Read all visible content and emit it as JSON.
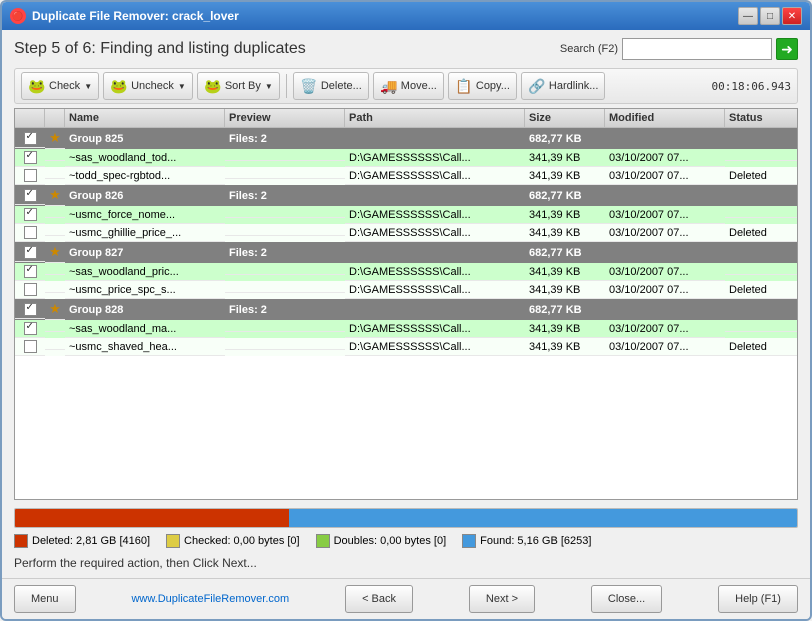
{
  "window": {
    "title": "Duplicate File Remover: crack_lover",
    "title_icon": "🔴"
  },
  "title_buttons": {
    "minimize": "—",
    "maximize": "□",
    "close": "✕"
  },
  "header": {
    "step_title": "Step 5 of 6: Finding and listing duplicates",
    "search_label": "Search (F2)",
    "search_placeholder": "",
    "go_arrow": "➜"
  },
  "toolbar": {
    "check_label": "Check",
    "uncheck_label": "Uncheck",
    "sort_label": "Sort By",
    "delete_label": "Delete...",
    "move_label": "Move...",
    "copy_label": "Copy...",
    "hardlink_label": "Hardlink...",
    "timer": "00:18:06.943"
  },
  "table": {
    "columns": [
      "",
      "",
      "Name",
      "Preview",
      "Path",
      "Size",
      "Modified",
      "Status"
    ],
    "groups": [
      {
        "id": "Group 825",
        "files": "Files: 2",
        "size": "682,77 KB",
        "rows": [
          {
            "checked": true,
            "name": "~sas_woodland_tod...",
            "path": "D:\\GAMESSSSSS\\Call...",
            "size": "341,39 KB",
            "modified": "03/10/2007 07...",
            "status": "",
            "green": true
          },
          {
            "checked": false,
            "name": "~todd_spec-rgbtod...",
            "path": "D:\\GAMESSSSSS\\Call...",
            "size": "341,39 KB",
            "modified": "03/10/2007 07...",
            "status": "Deleted",
            "green": false
          }
        ]
      },
      {
        "id": "Group 826",
        "files": "Files: 2",
        "size": "682,77 KB",
        "rows": [
          {
            "checked": true,
            "name": "~usmc_force_nome...",
            "path": "D:\\GAMESSSSSS\\Call...",
            "size": "341,39 KB",
            "modified": "03/10/2007 07...",
            "status": "",
            "green": true
          },
          {
            "checked": false,
            "name": "~usmc_ghillie_price_...",
            "path": "D:\\GAMESSSSSS\\Call...",
            "size": "341,39 KB",
            "modified": "03/10/2007 07...",
            "status": "Deleted",
            "green": false
          }
        ]
      },
      {
        "id": "Group 827",
        "files": "Files: 2",
        "size": "682,77 KB",
        "rows": [
          {
            "checked": true,
            "name": "~sas_woodland_pric...",
            "path": "D:\\GAMESSSSSS\\Call...",
            "size": "341,39 KB",
            "modified": "03/10/2007 07...",
            "status": "",
            "green": true
          },
          {
            "checked": false,
            "name": "~usmc_price_spc_s...",
            "path": "D:\\GAMESSSSSS\\Call...",
            "size": "341,39 KB",
            "modified": "03/10/2007 07...",
            "status": "Deleted",
            "green": false
          }
        ]
      },
      {
        "id": "Group 828",
        "files": "Files: 2",
        "size": "682,77 KB",
        "rows": [
          {
            "checked": true,
            "name": "~sas_woodland_ma...",
            "path": "D:\\GAMESSSSSS\\Call...",
            "size": "341,39 KB",
            "modified": "03/10/2007 07...",
            "status": "",
            "green": true
          },
          {
            "checked": false,
            "name": "~usmc_shaved_hea...",
            "path": "D:\\GAMESSSSSS\\Call...",
            "size": "341,39 KB",
            "modified": "03/10/2007 07...",
            "status": "Deleted",
            "green": false
          }
        ]
      }
    ]
  },
  "progress": {
    "deleted_pct": 35,
    "found_pct": 65
  },
  "legend": [
    {
      "color": "#cc3300",
      "label": "Deleted: 2,81 GB [4160]"
    },
    {
      "color": "#ddcc44",
      "label": "Checked: 0,00 bytes [0]"
    },
    {
      "color": "#88cc44",
      "label": "Doubles: 0,00 bytes [0]"
    },
    {
      "color": "#4499dd",
      "label": "Found: 5,16 GB [6253]"
    }
  ],
  "status_text": "Perform the required action, then Click Next...",
  "bottom": {
    "menu_label": "Menu",
    "website": "www.DuplicateFileRemover.com",
    "back_label": "< Back",
    "next_label": "Next >",
    "close_label": "Close...",
    "help_label": "Help (F1)"
  }
}
